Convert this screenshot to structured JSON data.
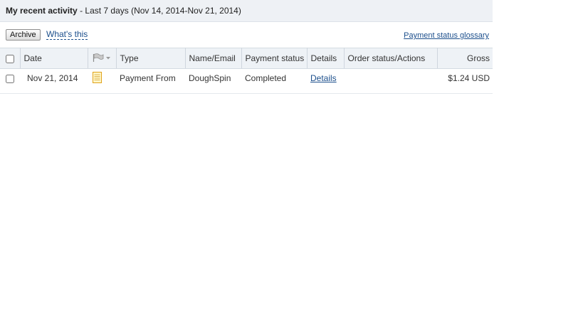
{
  "header": {
    "title": "My recent activity",
    "range": "- Last 7 days (Nov 14, 2014-Nov 21, 2014)"
  },
  "toolbar": {
    "archive_label": "Archive",
    "whats_this_label": "What's this",
    "glossary_label": "Payment status glossary"
  },
  "table": {
    "columns": {
      "date": "Date",
      "type": "Type",
      "name": "Name/Email",
      "status": "Payment status",
      "details": "Details",
      "order": "Order status/Actions",
      "gross": "Gross"
    },
    "rows": [
      {
        "date": "Nov 21, 2014",
        "type": "Payment From",
        "name": "DoughSpin",
        "status": "Completed",
        "details": "Details",
        "order": "",
        "gross": "$1.24 USD"
      }
    ]
  },
  "icons": {
    "flag_filter": "flag-filter-icon",
    "note": "note-icon"
  },
  "colors": {
    "link": "#1c4f8c",
    "header_bg": "#eef1f5"
  }
}
